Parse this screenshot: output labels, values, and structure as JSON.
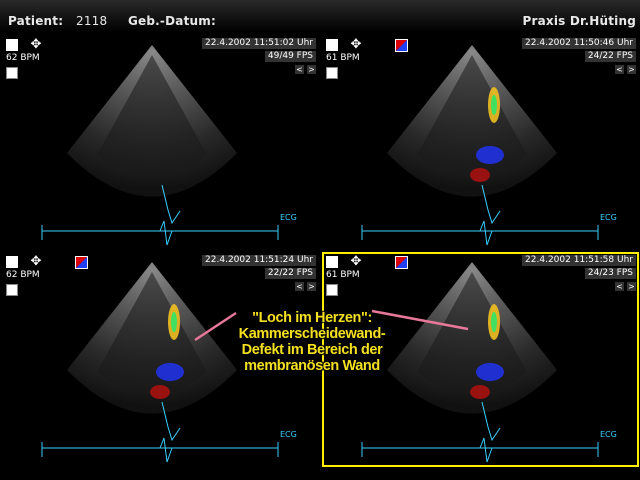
{
  "header": {
    "patient_label": "Patient:",
    "patient_id": "2118",
    "dob_label": "Geb.-Datum:",
    "practice": "Praxis Dr.Hüting"
  },
  "panels": [
    {
      "timestamp": "22.4.2002 11:51:02 Uhr",
      "fps": "49/49 FPS",
      "bpm": "62 BPM",
      "ecg": "ECG",
      "doppler": false,
      "active": false
    },
    {
      "timestamp": "22.4.2002 11:50:46 Uhr",
      "fps": "24/22 FPS",
      "bpm": "61 BPM",
      "ecg": "ECG",
      "doppler": true,
      "active": false
    },
    {
      "timestamp": "22.4.2002 11:51:24 Uhr",
      "fps": "22/22 FPS",
      "bpm": "62 BPM",
      "ecg": "ECG",
      "doppler": true,
      "active": false
    },
    {
      "timestamp": "22.4.2002 11:51:58 Uhr",
      "fps": "24/23 FPS",
      "bpm": "61 BPM",
      "ecg": "ECG",
      "doppler": true,
      "active": true
    }
  ],
  "nav": {
    "prev": "<",
    "next": ">"
  },
  "icons": {
    "lock": "lock-icon",
    "move": "move-icon",
    "doppler": "color-doppler-icon",
    "probe": "probe-icon"
  },
  "annotation": {
    "line1": "\"Loch im Herzen\":",
    "line2": "Kammerscheidewand-",
    "line3": "Defekt im Bereich der",
    "line4": "membranösen Wand"
  },
  "colors": {
    "highlight": "#ffee00",
    "annotation": "#f4e020",
    "ecg": "#3ad0ff",
    "pointer": "#e8789a"
  }
}
